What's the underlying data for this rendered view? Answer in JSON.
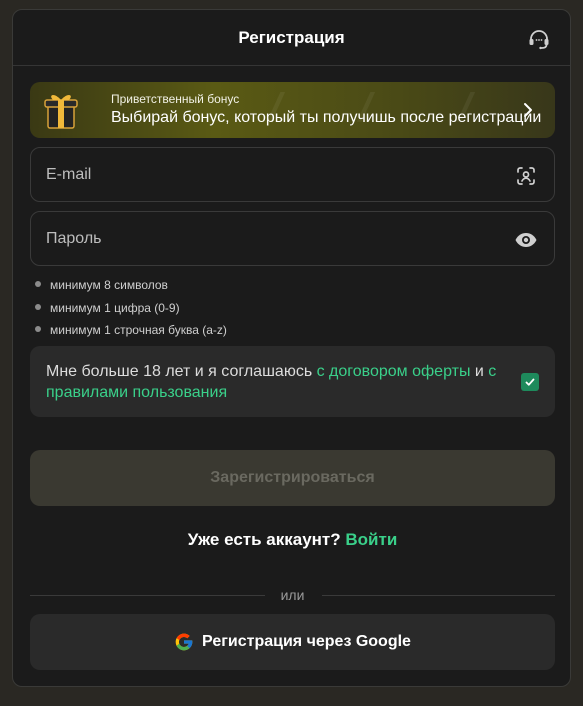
{
  "header": {
    "title": "Регистрация",
    "support_icon": "headset-icon"
  },
  "banner": {
    "small_text": "Приветственный бонус",
    "main_text": "Выбирай бонус, который ты получишь после регистрации",
    "icon": "gift-icon"
  },
  "email": {
    "placeholder": "E-mail",
    "icon": "face-scan-icon"
  },
  "password": {
    "placeholder": "Пароль",
    "icon": "eye-icon"
  },
  "password_rules": [
    "минимум 8 символов",
    "минимум 1 цифра (0-9)",
    "минимум 1 строчная буква (a-z)"
  ],
  "agreement": {
    "prefix": "Мне больше 18 лет и я соглашаюсь ",
    "link1": "с договором оферты",
    "middle": " и ",
    "link2": "с правилами пользования",
    "checked": true
  },
  "submit_label": "Зарегистрироваться",
  "login_prompt": {
    "text": "Уже есть аккаунт?",
    "link": "Войти"
  },
  "divider_text": "или",
  "google_label": "Регистрация через Google",
  "colors": {
    "accent": "#3ad08a",
    "background": "#1b1b1b",
    "card": "#2a2a2a",
    "checkbox": "#1e8a5c"
  }
}
